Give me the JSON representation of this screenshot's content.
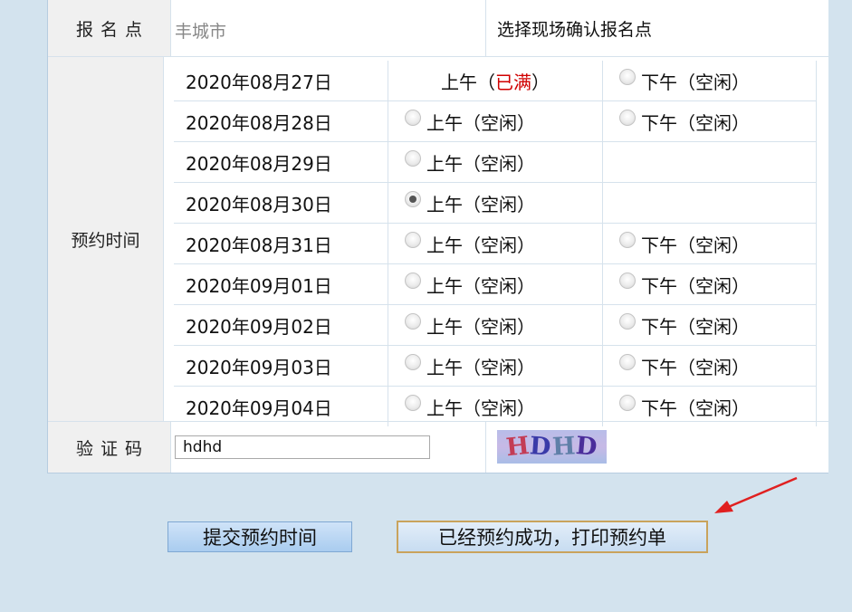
{
  "site": {
    "label": "报名点",
    "value": "丰城市",
    "action": "选择现场确认报名点"
  },
  "appointment": {
    "label": "预约时间",
    "slots": [
      {
        "date": "2020年08月27日",
        "am": {
          "text": "上午",
          "status": "已满",
          "full": true
        },
        "pm": {
          "text": "下午",
          "status": "空闲"
        }
      },
      {
        "date": "2020年08月28日",
        "am": {
          "text": "上午",
          "status": "空闲"
        },
        "pm": {
          "text": "下午",
          "status": "空闲"
        }
      },
      {
        "date": "2020年08月29日",
        "am": {
          "text": "上午",
          "status": "空闲"
        },
        "pm": null
      },
      {
        "date": "2020年08月30日",
        "am": {
          "text": "上午",
          "status": "空闲",
          "selected": true
        },
        "pm": null
      },
      {
        "date": "2020年08月31日",
        "am": {
          "text": "上午",
          "status": "空闲"
        },
        "pm": {
          "text": "下午",
          "status": "空闲"
        }
      },
      {
        "date": "2020年09月01日",
        "am": {
          "text": "上午",
          "status": "空闲"
        },
        "pm": {
          "text": "下午",
          "status": "空闲"
        }
      },
      {
        "date": "2020年09月02日",
        "am": {
          "text": "上午",
          "status": "空闲"
        },
        "pm": {
          "text": "下午",
          "status": "空闲"
        }
      },
      {
        "date": "2020年09月03日",
        "am": {
          "text": "上午",
          "status": "空闲"
        },
        "pm": {
          "text": "下午",
          "status": "空闲"
        }
      },
      {
        "date": "2020年09月04日",
        "am": {
          "text": "上午",
          "status": "空闲"
        },
        "pm": {
          "text": "下午",
          "status": "空闲"
        }
      }
    ]
  },
  "captcha": {
    "label": "验证码",
    "input_value": "hdhd",
    "image_text": "HDHD"
  },
  "buttons": {
    "submit": "提交预约时间",
    "print": "已经预约成功，打印预约单"
  },
  "colors": {
    "page_bg": "#d3e3ee",
    "full_status": "#d00000",
    "annotation_arrow": "#e02020",
    "print_button_border": "#c9a35c"
  },
  "icons": {
    "radio": "radio-button",
    "arrow": "red-annotation-arrow"
  }
}
